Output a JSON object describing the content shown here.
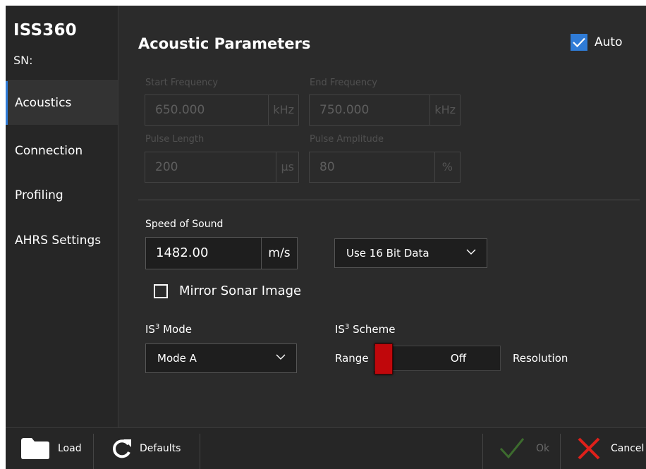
{
  "app": {
    "brand": "ISS360",
    "serial_label": "SN:"
  },
  "sidebar": {
    "items": [
      {
        "label": "Acoustics",
        "active": true
      },
      {
        "label": "Connection",
        "active": false
      },
      {
        "label": "Profiling",
        "active": false
      },
      {
        "label": "AHRS Settings",
        "active": false
      }
    ]
  },
  "main": {
    "title": "Acoustic Parameters",
    "auto": {
      "label": "Auto",
      "checked": true
    },
    "start_frequency": {
      "label": "Start Frequency",
      "value": "650.000",
      "unit": "kHz"
    },
    "end_frequency": {
      "label": "End Frequency",
      "value": "750.000",
      "unit": "kHz"
    },
    "pulse_length": {
      "label": "Pulse Length",
      "value": "200",
      "unit": "µs"
    },
    "pulse_amplitude": {
      "label": "Pulse Amplitude",
      "value": "80",
      "unit": "%"
    },
    "speed_of_sound": {
      "label": "Speed of Sound",
      "value": "1482.00",
      "unit": "m/s"
    },
    "data_bits": {
      "selected": "Use 16 Bit Data"
    },
    "mirror": {
      "label": "Mirror Sonar Image",
      "checked": false
    },
    "is3_mode": {
      "label_prefix": "IS",
      "label_sup": "3",
      "label_suffix": " Mode",
      "selected": "Mode A"
    },
    "is3_scheme": {
      "label_prefix": "IS",
      "label_sup": "3",
      "label_suffix": " Scheme",
      "left_label": "Range",
      "state": "Off",
      "right_label": "Resolution"
    }
  },
  "footer": {
    "load": "Load",
    "defaults": "Defaults",
    "ok": "Ok",
    "cancel": "Cancel"
  },
  "colors": {
    "accent": "#2f7bd6",
    "toggle_knob": "#c0070b",
    "cancel_x": "#e0201a",
    "ok_check_disabled": "#3d6b2e"
  }
}
